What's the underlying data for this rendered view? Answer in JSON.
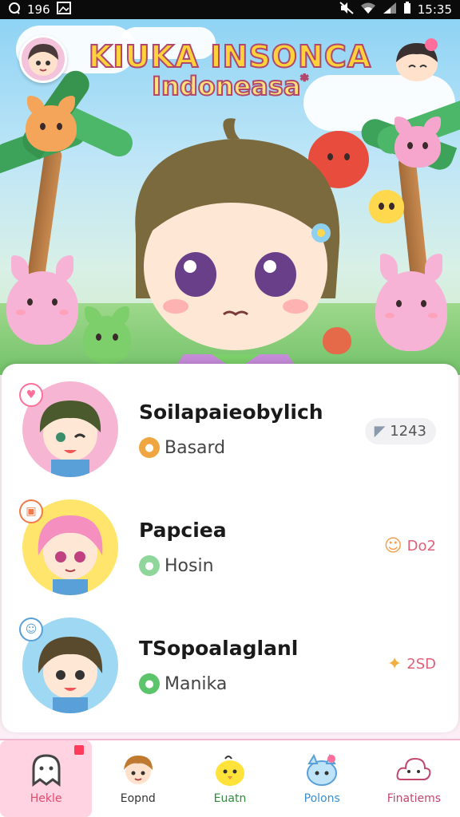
{
  "status_bar": {
    "left_text": "196",
    "time": "15:35",
    "left_icon": "chat-icon",
    "image_icon": "image-icon",
    "mute_icon": "mute-icon",
    "wifi_icon": "wifi-icon",
    "signal_icon": "signal-icon",
    "battery_icon": "battery-icon"
  },
  "hero": {
    "title_line1": "KIUKA INSONCA",
    "title_line2": "Indoneasa",
    "title_star": "*"
  },
  "list": {
    "items": [
      {
        "name": "Soilapaieobylich",
        "subtitle": "Basard",
        "subtitle_icon": "medal-icon",
        "stat": "1243",
        "stat_icon": "ribbon-icon",
        "badge_icon": "heart-icon",
        "accent": "#f38bb0"
      },
      {
        "name": "Papciea",
        "subtitle": "Hosin",
        "subtitle_icon": "frog-icon",
        "stat": "Do2",
        "stat_icon": "cat-face-icon",
        "badge_icon": "chat-bubble-icon",
        "accent": "#ffd84d"
      },
      {
        "name": "TSopoalaglanl",
        "subtitle": "Manika",
        "subtitle_icon": "frog-icon",
        "stat": "2SD",
        "stat_icon": "star-burst-icon",
        "badge_icon": "speech-bubble-icon",
        "accent": "#8fd0f0"
      }
    ]
  },
  "nav": {
    "items": [
      {
        "label": "Hekle",
        "icon": "ghost-icon",
        "color": "#e04b6f",
        "active": true
      },
      {
        "label": "Eopnd",
        "icon": "boy-face-icon",
        "color": "#333333",
        "active": false
      },
      {
        "label": "Euatn",
        "icon": "chick-icon",
        "color": "#2e8b3a",
        "active": false
      },
      {
        "label": "Polons",
        "icon": "blue-creature-icon",
        "color": "#3a8fd0",
        "active": false
      },
      {
        "label": "Finatiems",
        "icon": "cloud-icon",
        "color": "#c2476c",
        "active": false
      }
    ]
  },
  "colors": {
    "accent": "#ff6f9a",
    "title_fill": "#ffd23b",
    "title_stroke": "#b0486e"
  }
}
